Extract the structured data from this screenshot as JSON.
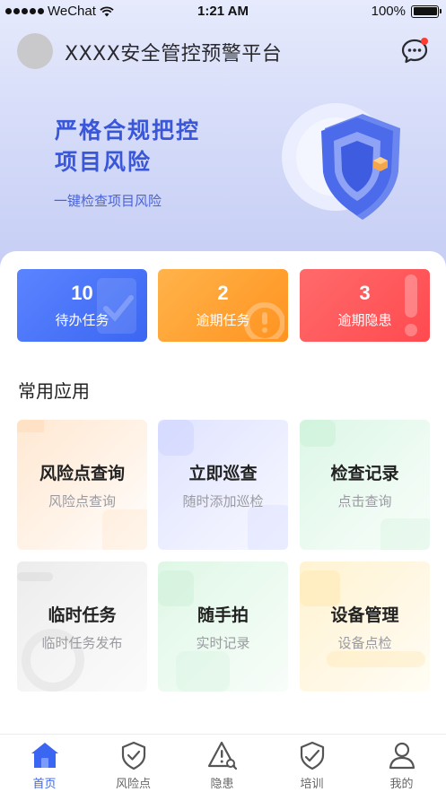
{
  "status_bar": {
    "carrier": "WeChat",
    "time": "1:21 AM",
    "battery": "100%"
  },
  "header": {
    "title": "XXXX安全管控预警平台",
    "message_icon": "chat-bubble-icon"
  },
  "banner": {
    "slogan_line1": "严格合规把控",
    "slogan_line2": "项目风险",
    "subtitle": "一键检查项目风险",
    "art_icon": "shield-icon"
  },
  "stats": [
    {
      "value": "10",
      "label": "待办任务",
      "color": "#4a76fa"
    },
    {
      "value": "2",
      "label": "逾期任务",
      "color": "#ffa233"
    },
    {
      "value": "3",
      "label": "逾期隐患",
      "color": "#ff5a5e"
    }
  ],
  "apps_section": {
    "title": "常用应用",
    "tiles": [
      {
        "title": "风险点查询",
        "subtitle": "风险点查询"
      },
      {
        "title": "立即巡查",
        "subtitle": "随时添加巡检"
      },
      {
        "title": "检查记录",
        "subtitle": "点击查询"
      },
      {
        "title": "临时任务",
        "subtitle": "临时任务发布"
      },
      {
        "title": "随手拍",
        "subtitle": "实时记录"
      },
      {
        "title": "设备管理",
        "subtitle": "设备点检"
      }
    ]
  },
  "tabbar": {
    "active_color": "#3b66f2",
    "items": [
      {
        "label": "首页",
        "icon": "home-icon"
      },
      {
        "label": "风险点",
        "icon": "shield-check-icon"
      },
      {
        "label": "隐患",
        "icon": "warning-search-icon"
      },
      {
        "label": "培训",
        "icon": "training-shield-icon"
      },
      {
        "label": "我的",
        "icon": "user-icon"
      }
    ]
  }
}
